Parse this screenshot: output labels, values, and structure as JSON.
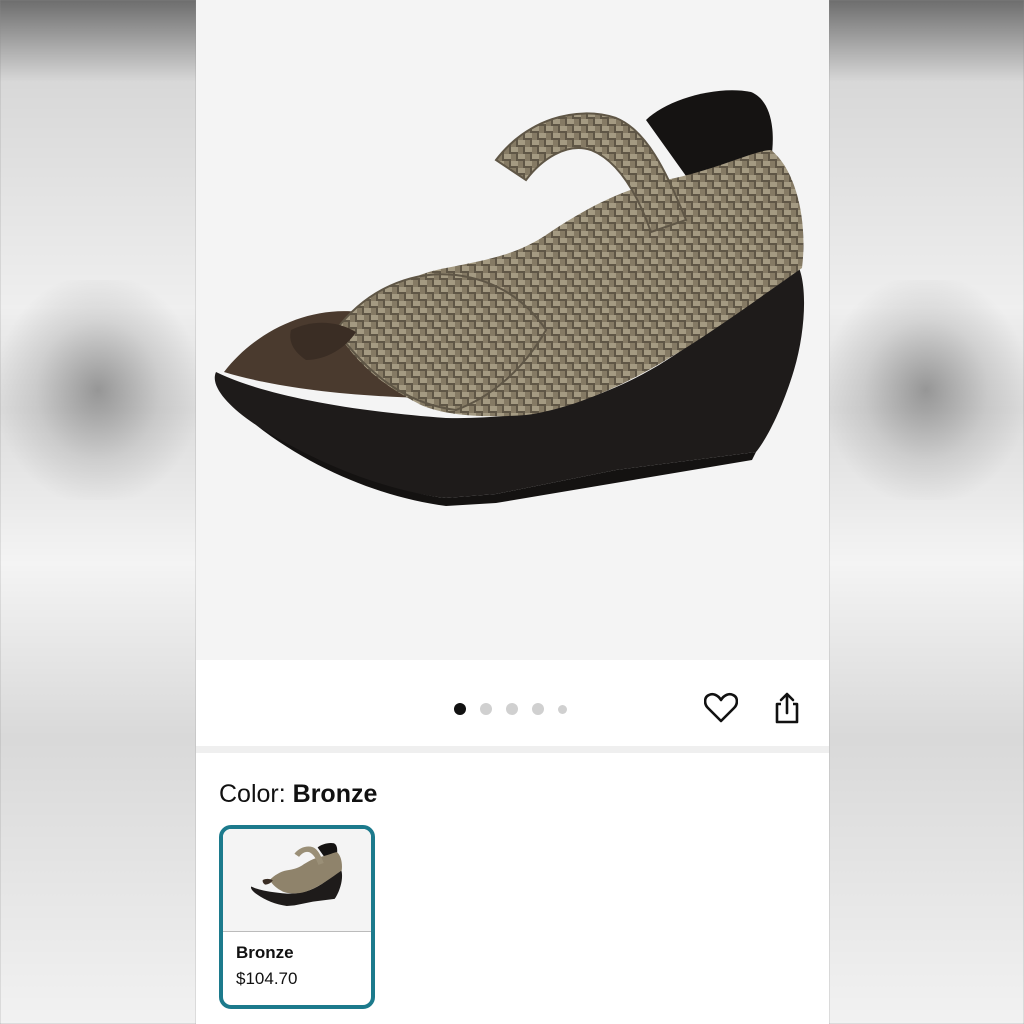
{
  "gallery": {
    "image_alt": "Woven bronze peep-toe wedge shoe",
    "dots": [
      {
        "active": true
      },
      {
        "active": false
      },
      {
        "active": false
      },
      {
        "active": false
      },
      {
        "active": false,
        "small": true
      }
    ],
    "favorite_icon": "heart-outline-icon",
    "share_icon": "share-icon"
  },
  "color_selector": {
    "label": "Color:",
    "selected": "Bronze"
  },
  "swatches": [
    {
      "name": "Bronze",
      "price": "$104.70",
      "selected": true
    }
  ],
  "colors": {
    "accent": "#1c7a8c",
    "sole": "#1e1b1a",
    "upper": "#8a7d66"
  }
}
